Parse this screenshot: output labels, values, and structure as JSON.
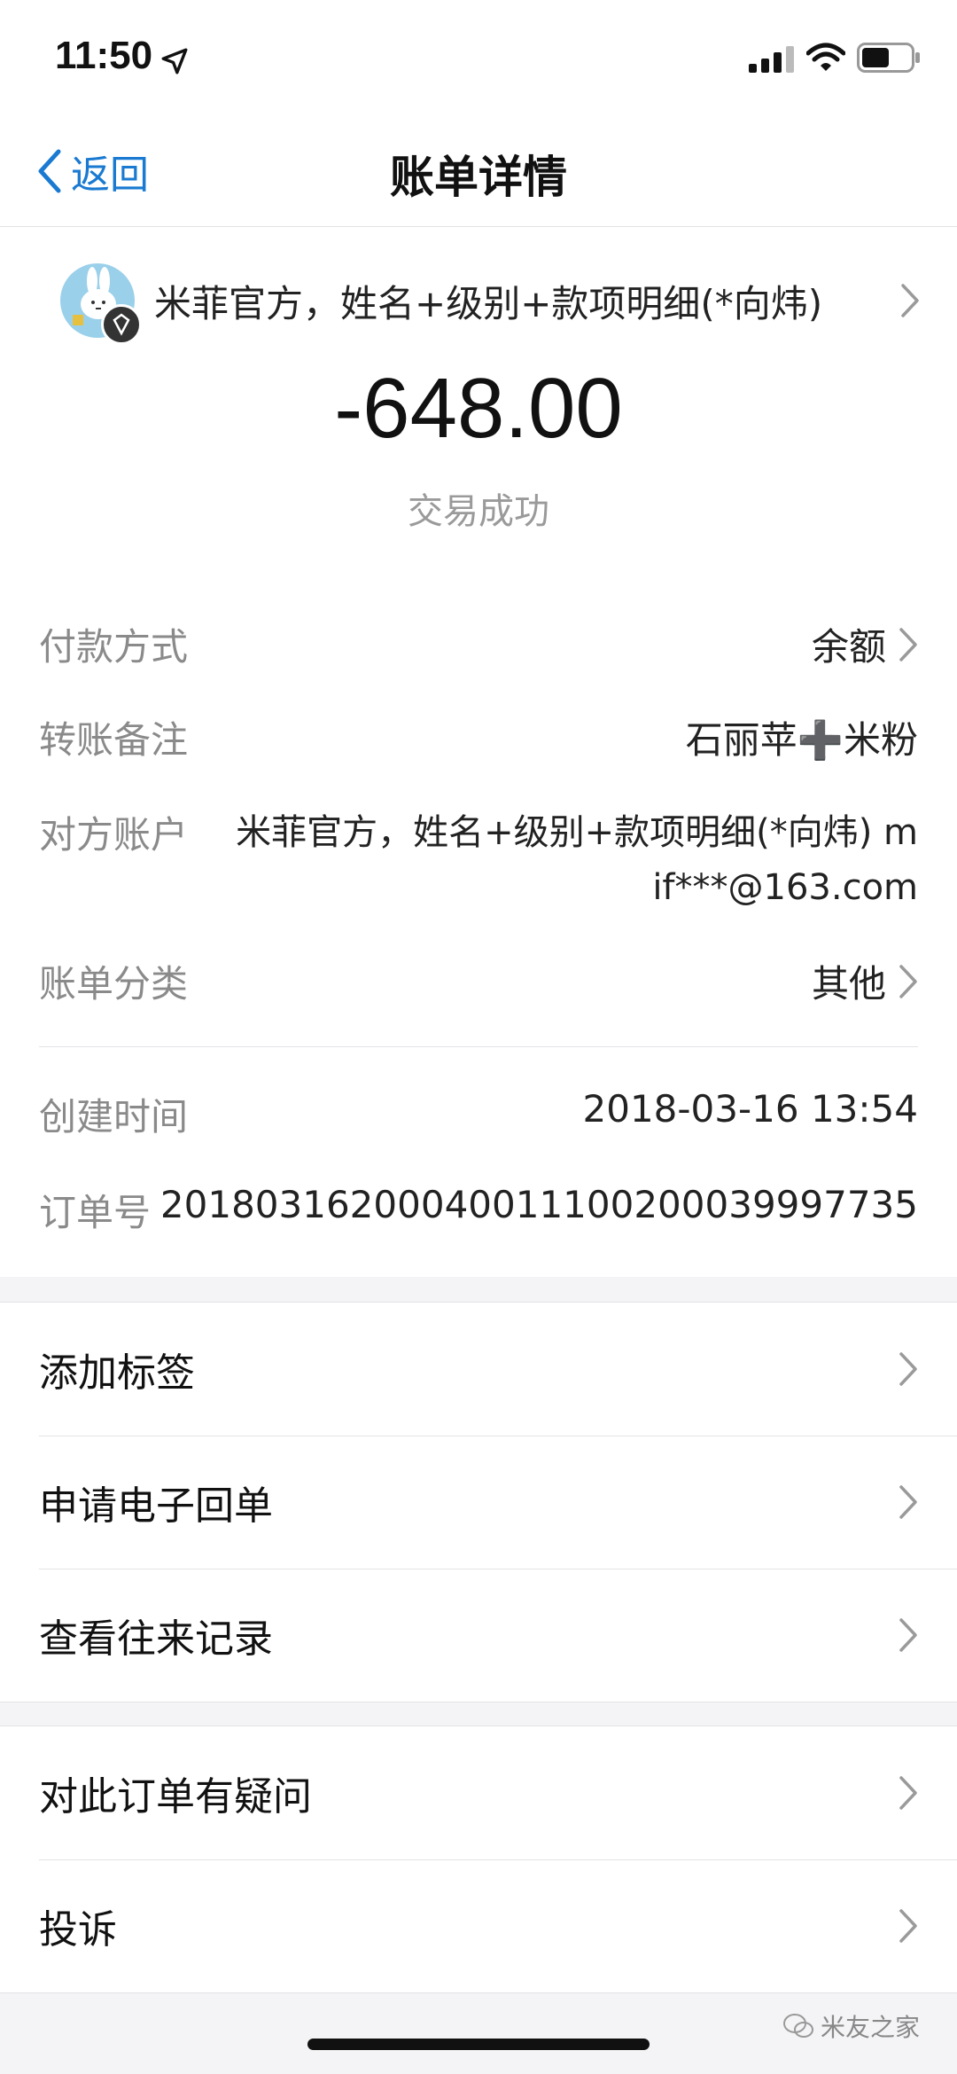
{
  "status_bar": {
    "time": "11:50",
    "icons": [
      "location-arrow-icon",
      "signal-icon",
      "wifi-icon",
      "battery-icon"
    ]
  },
  "nav": {
    "back_label": "返回",
    "title": "账单详情"
  },
  "merchant": {
    "name": "米菲官方，姓名+级别+款项明细(*向炜)"
  },
  "amount": "-648.00",
  "status": "交易成功",
  "details": [
    {
      "label": "付款方式",
      "value": "余额"
    },
    {
      "label": "转账备注",
      "value": "石丽苹➕米粉"
    },
    {
      "label": "对方账户",
      "value_line1": "米菲官方，姓名+级别+款项明细(*向炜) m",
      "value_line2": "if***@163.com"
    },
    {
      "label": "账单分类",
      "value": "其他"
    },
    {
      "label": "创建时间",
      "value": "2018-03-16 13:54"
    },
    {
      "label": "订单号",
      "value": "20180316200040011100200039997735"
    }
  ],
  "menu_group_1": [
    {
      "label": "添加标签"
    },
    {
      "label": "申请电子回单"
    },
    {
      "label": "查看往来记录"
    }
  ],
  "menu_group_2": [
    {
      "label": "对此订单有疑问"
    },
    {
      "label": "投诉"
    }
  ],
  "watermark": "米友之家",
  "colors": {
    "accent": "#1a7ad1",
    "background": "#f4f4f6",
    "label_gray": "#8a8a8a"
  }
}
